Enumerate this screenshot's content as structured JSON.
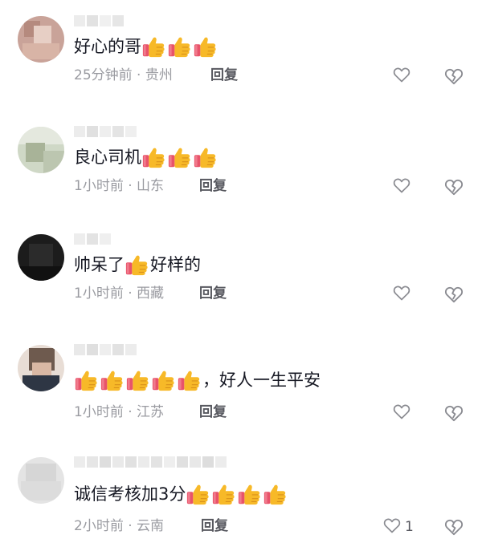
{
  "comments": [
    {
      "text": "好心的哥",
      "thumbs_before": 0,
      "thumbs_after": 3,
      "suffix": "",
      "time": "25分钟前",
      "location": "贵州",
      "reply_label": "回复",
      "like_count": ""
    },
    {
      "text": "良心司机",
      "thumbs_before": 0,
      "thumbs_after": 3,
      "suffix": "",
      "time": "1小时前",
      "location": "山东",
      "reply_label": "回复",
      "like_count": ""
    },
    {
      "text": "帅呆了",
      "thumbs_before": 0,
      "thumbs_after": 1,
      "suffix": "好样的",
      "time": "1小时前",
      "location": "西藏",
      "reply_label": "回复",
      "like_count": ""
    },
    {
      "text": "",
      "thumbs_before": 5,
      "thumbs_after": 0,
      "suffix": "，好人一生平安",
      "time": "1小时前",
      "location": "江苏",
      "reply_label": "回复",
      "like_count": ""
    },
    {
      "text": "诚信考核加3分",
      "thumbs_before": 0,
      "thumbs_after": 4,
      "suffix": "",
      "time": "2小时前",
      "location": "云南",
      "reply_label": "回复",
      "like_count": "1"
    }
  ],
  "separator": "·",
  "icons": {
    "like": "heart-outline-icon",
    "dislike": "broken-heart-icon",
    "emoji": "thumbs-up-emoji"
  },
  "colors": {
    "text": "#161823",
    "meta": "#9a9ba1",
    "reply": "#57585f",
    "icon": "#8a8b91"
  }
}
